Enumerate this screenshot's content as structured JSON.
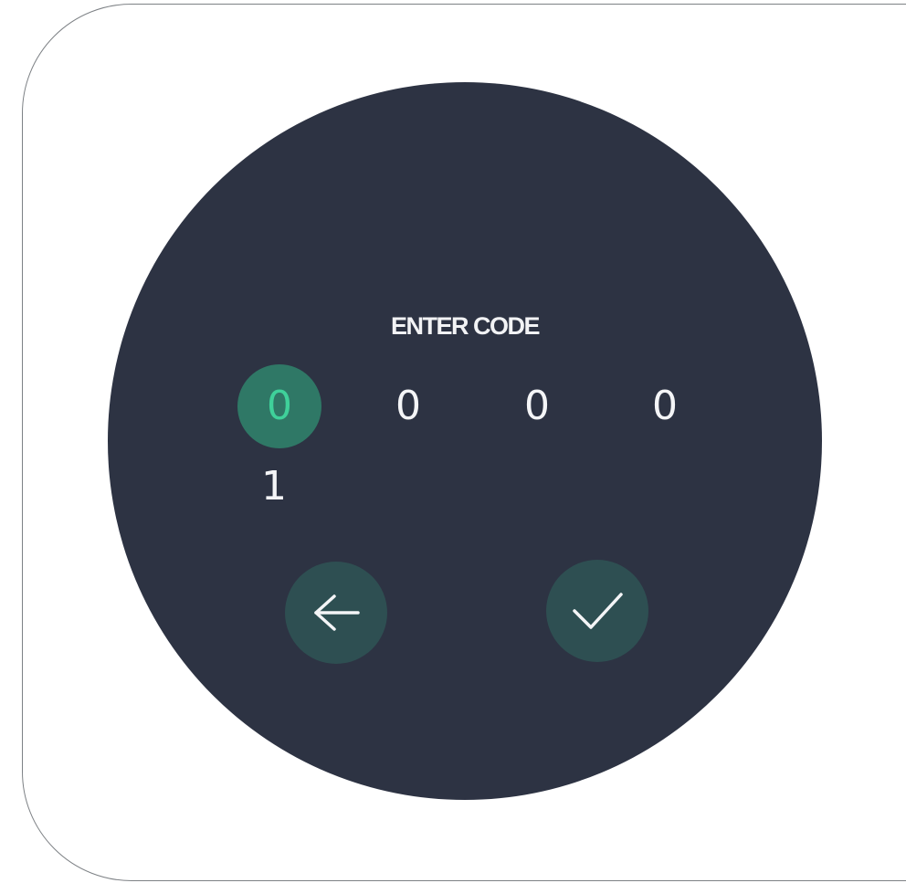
{
  "screen": {
    "title": "ENTER CODE"
  },
  "code_entry": {
    "digits": [
      "0",
      "0",
      "0",
      "0"
    ],
    "active_index": 0,
    "next_value_preview": "1"
  },
  "actions": {
    "back": {
      "icon": "arrow-left-icon"
    },
    "confirm": {
      "icon": "checkmark-icon"
    }
  },
  "colors": {
    "background": "#ffffff",
    "watch_face": "#2d3343",
    "active_digit_bg": "#2f7866",
    "active_digit_text": "#3fd19a",
    "action_button_bg": "#2e4f52",
    "text": "#f4f5f7"
  }
}
